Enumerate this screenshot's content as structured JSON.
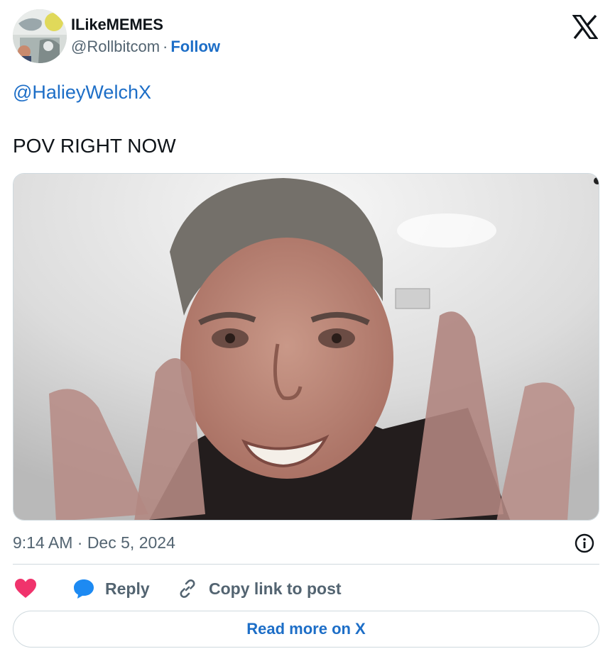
{
  "user": {
    "display_name": "ILikeMEMES",
    "handle": "@Rollbitcom",
    "separator": "·",
    "follow_label": "Follow"
  },
  "tweet": {
    "mention": "@HalieyWelchX",
    "text": "POV RIGHT NOW",
    "timestamp": "9:14 AM · Dec 5, 2024"
  },
  "actions": {
    "reply_label": "Reply",
    "copy_label": "Copy link to post",
    "read_more_label": "Read more on X"
  },
  "icons": {
    "brand": "x-logo-icon",
    "info": "info-icon",
    "like": "heart-icon",
    "reply": "speech-bubble-icon",
    "copy": "link-icon"
  },
  "colors": {
    "link": "#1d6ec7",
    "text": "#0f1419",
    "muted": "#536471",
    "like": "#f0336c",
    "reply": "#1d8af2",
    "border": "#cfd9de"
  }
}
